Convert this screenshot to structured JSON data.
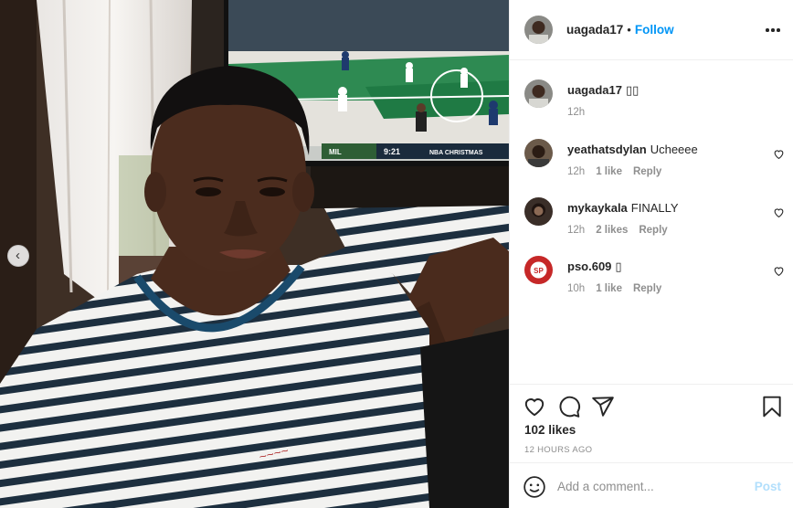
{
  "post": {
    "username": "uagada17",
    "follow_label": "Follow",
    "dot": "•"
  },
  "photo": {
    "scoreboard": [
      "MIL",
      "9:21",
      "NBA CHRISTMAS"
    ]
  },
  "comments": [
    {
      "username": "uagada17",
      "text": "▯▯",
      "time": "12h",
      "likes": "",
      "reply": ""
    },
    {
      "username": "yeathatsdylan",
      "text": "Ucheeee",
      "time": "12h",
      "likes": "1 like",
      "reply": "Reply"
    },
    {
      "username": "mykaykala",
      "text": "FINALLY",
      "time": "12h",
      "likes": "2 likes",
      "reply": "Reply"
    },
    {
      "username": "pso.609",
      "text": "▯",
      "time": "10h",
      "likes": "1 like",
      "reply": "Reply"
    }
  ],
  "engagement": {
    "likes": "102 likes",
    "time_ago": "12 HOURS AGO"
  },
  "composer": {
    "placeholder": "Add a comment...",
    "post_label": "Post"
  },
  "colors": {
    "follow": "#0095f6",
    "post_disabled": "#b2dffc",
    "meta_gray": "#8e8e8e",
    "text": "#262626",
    "divider": "#efefef"
  },
  "icons": [
    "more-options-icon",
    "heart-icon",
    "comment-icon",
    "share-icon",
    "bookmark-icon",
    "emoji-icon",
    "carousel-prev-icon"
  ]
}
